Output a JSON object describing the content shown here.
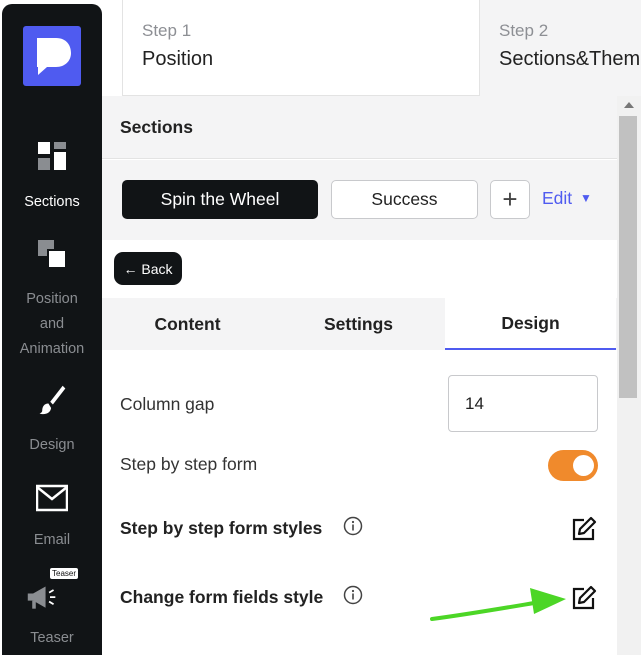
{
  "sidebar": {
    "items": [
      {
        "label": "Sections",
        "icon": "sections-icon",
        "active": true
      },
      {
        "label": "Position and Animation",
        "label_lines": [
          "Position",
          "and",
          "Animation"
        ],
        "icon": "position-icon",
        "active": false
      },
      {
        "label": "Design",
        "icon": "brush-icon",
        "active": false
      },
      {
        "label": "Email",
        "icon": "email-icon",
        "active": false
      },
      {
        "label": "Teaser",
        "icon": "megaphone-icon",
        "active": false,
        "badge": "Teaser"
      }
    ]
  },
  "steps": [
    {
      "number": "Step 1",
      "title": "Position"
    },
    {
      "number": "Step 2",
      "title": "Sections&Theme"
    }
  ],
  "panel": {
    "title": "Sections",
    "section_buttons": [
      "Spin the Wheel",
      "Success"
    ],
    "add_label": "+",
    "edit_label": "Edit",
    "back_label": "← Back",
    "tabs": [
      {
        "label": "Content",
        "active": false
      },
      {
        "label": "Settings",
        "active": false
      },
      {
        "label": "Design",
        "active": true
      }
    ]
  },
  "design": {
    "column_gap_label": "Column gap",
    "column_gap_value": "14",
    "step_form_label": "Step by step form",
    "step_form_enabled": true,
    "step_form_styles_label": "Step by step form styles",
    "form_fields_style_label": "Change form fields style"
  },
  "colors": {
    "accent": "#4f5bf0",
    "toggle_on": "#f08a2c",
    "sidebar_bg": "#111416",
    "arrow": "#4cd626"
  }
}
